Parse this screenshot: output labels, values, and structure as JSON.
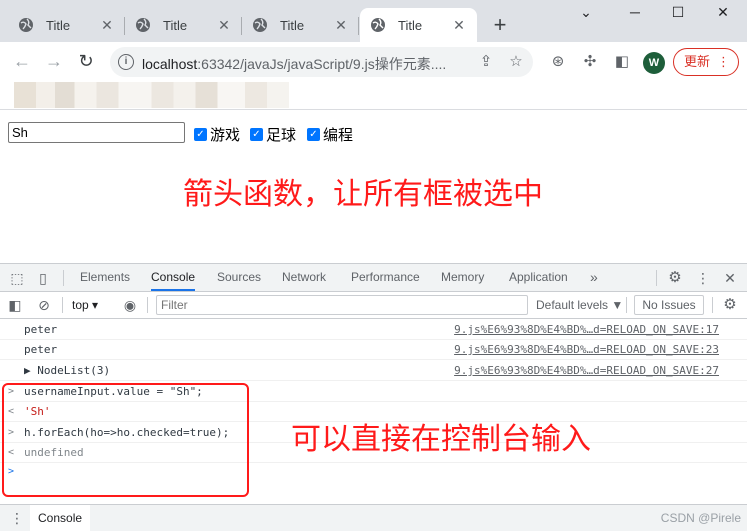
{
  "tabs": [
    {
      "title": "Title",
      "active": false
    },
    {
      "title": "Title",
      "active": false
    },
    {
      "title": "Title",
      "active": false
    },
    {
      "title": "Title",
      "active": true
    }
  ],
  "window": {
    "minimize": "─",
    "maximize": "☐",
    "close": "✕",
    "new_tab": "+"
  },
  "address": {
    "host": "localhost",
    "path": ":63342/javaJs/javaScript/9.js操作元素...."
  },
  "toolbar": {
    "avatar_letter": "W",
    "update_label": "更新"
  },
  "page": {
    "input_value": "Sh",
    "checkboxes": [
      {
        "label": "游戏",
        "checked": true
      },
      {
        "label": "足球",
        "checked": true
      },
      {
        "label": "编程",
        "checked": true
      }
    ],
    "heading": "箭头函数，让所有框被选中"
  },
  "devtools": {
    "tabs": [
      "Elements",
      "Console",
      "Sources",
      "Network",
      "Performance",
      "Memory",
      "Application"
    ],
    "active_tab": "Console",
    "more": "»",
    "context": "top",
    "filter_placeholder": "Filter",
    "levels": "Default levels ▼",
    "issues": "No Issues",
    "logs": [
      {
        "text": "peter",
        "source": "9.js%E6%93%8D%E4%BD%…d=RELOAD_ON_SAVE:17"
      },
      {
        "text": "peter",
        "source": "9.js%E6%93%8D%E4%BD%…d=RELOAD_ON_SAVE:23"
      },
      {
        "text": "▶ NodeList(3)",
        "source": "9.js%E6%93%8D%E4%BD%…d=RELOAD_ON_SAVE:27"
      }
    ],
    "inputs": [
      {
        "gutter": ">",
        "text": "usernameInput.value = \"Sh\";"
      },
      {
        "gutter": "<",
        "text": "'Sh'"
      },
      {
        "gutter": ">",
        "text": "h.forEach(ho=>ho.checked=true);"
      },
      {
        "gutter": "<",
        "text": "undefined"
      },
      {
        "gutter": ">",
        "text": ""
      }
    ],
    "annotation": "可以直接在控制台输入",
    "drawer_tab": "Console"
  },
  "watermark": "CSDN @Pirele",
  "colors": {
    "accent_red": "#ff1a1a",
    "checkbox_blue": "#0075ff",
    "tab_underline": "#1a73e8"
  }
}
